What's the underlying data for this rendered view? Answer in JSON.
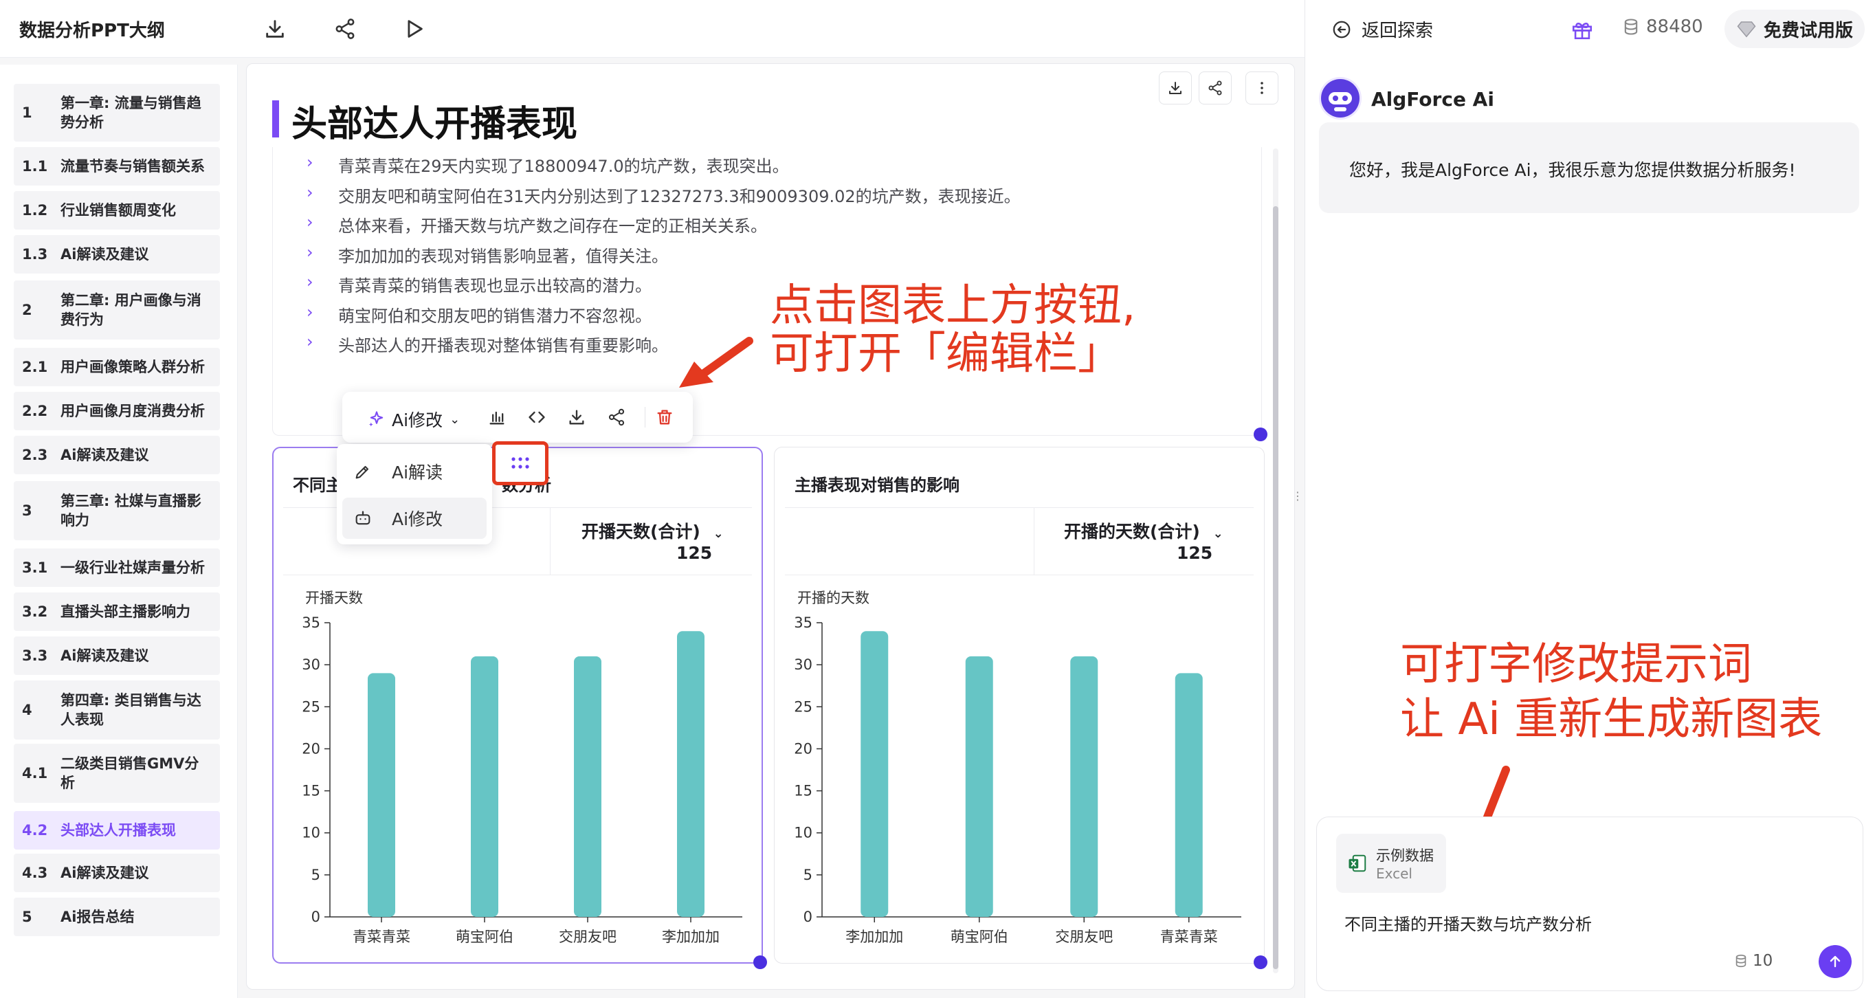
{
  "app": {
    "doc_title": "数据分析PPT大纲"
  },
  "outline": [
    {
      "num": "1",
      "label": "第一章: 流量与销售趋势分析"
    },
    {
      "num": "1.1",
      "label": "流量节奏与销售额关系"
    },
    {
      "num": "1.2",
      "label": "行业销售额周变化"
    },
    {
      "num": "1.3",
      "label": "Ai解读及建议"
    },
    {
      "num": "2",
      "label": "第二章: 用户画像与消费行为"
    },
    {
      "num": "2.1",
      "label": "用户画像策略人群分析"
    },
    {
      "num": "2.2",
      "label": "用户画像月度消费分析"
    },
    {
      "num": "2.3",
      "label": "Ai解读及建议"
    },
    {
      "num": "3",
      "label": "第三章: 社媒与直播影响力"
    },
    {
      "num": "3.1",
      "label": "一级行业社媒声量分析"
    },
    {
      "num": "3.2",
      "label": "直播头部主播影响力"
    },
    {
      "num": "3.3",
      "label": "Ai解读及建议"
    },
    {
      "num": "4",
      "label": "第四章: 类目销售与达人表现"
    },
    {
      "num": "4.1",
      "label": "二级类目销售GMV分析"
    },
    {
      "num": "4.2",
      "label": "头部达人开播表现"
    },
    {
      "num": "4.3",
      "label": "Ai解读及建议"
    },
    {
      "num": "5",
      "label": "Ai报告总结"
    }
  ],
  "slide": {
    "title": "头部达人开播表现",
    "insights": [
      "青菜青菜在29天内实现了18800947.0的坑产数，表现突出。",
      "交朋友吧和萌宝阿伯在31天内分别达到了12327273.3和9009309.02的坑产数，表现接近。",
      "总体来看，开播天数与坑产数之间存在一定的正相关关系。",
      "李加加加的表现对销售影响显著，值得关注。",
      "青菜青菜的销售表现也显示出较高的潜力。",
      "萌宝阿伯和交朋友吧的销售潜力不容忽视。",
      "头部达人的开播表现对整体销售有重要影响。"
    ]
  },
  "annotations": {
    "top_line1": "点击图表上方按钮,",
    "top_line2": "可打开「编辑栏」",
    "bottom_line1": "可打字修改提示词",
    "bottom_line2": "让 Ai 重新生成新图表"
  },
  "toolbar": {
    "ai_edit_label": "Ai修改"
  },
  "dropdown": {
    "items": [
      "Ai解读",
      "Ai修改"
    ]
  },
  "cards": [
    {
      "title_visible_start": "不同主",
      "title_visible_end": "数分析",
      "metric_label": "开播天数(合计)",
      "metric_value": "125",
      "ylabel": "开播天数"
    },
    {
      "title": "主播表现对销售的影响",
      "metric_label": "开播的天数(合计)",
      "metric_value": "125",
      "ylabel": "开播的天数"
    }
  ],
  "chart_data": [
    {
      "type": "bar",
      "categories": [
        "青菜青菜",
        "萌宝阿伯",
        "交朋友吧",
        "李加加加"
      ],
      "values": [
        29,
        31,
        31,
        34
      ],
      "ylabel": "开播天数",
      "ylim": [
        0,
        35
      ],
      "yticks": [
        0,
        5,
        10,
        15,
        20,
        25,
        30,
        35
      ],
      "color": "#66c5c5"
    },
    {
      "type": "bar",
      "categories": [
        "李加加加",
        "萌宝阿伯",
        "交朋友吧",
        "青菜青菜"
      ],
      "values": [
        34,
        31,
        31,
        29
      ],
      "ylabel": "开播的天数",
      "ylim": [
        0,
        35
      ],
      "yticks": [
        0,
        5,
        10,
        15,
        20,
        25,
        30,
        35
      ],
      "color": "#66c5c5"
    }
  ],
  "chat": {
    "back_label": "返回探索",
    "credits": "88480",
    "trial_label": "免费试用版",
    "bot_name": "AlgForce Ai",
    "greeting": "您好，我是AlgForce Ai，我很乐意为您提供数据分析服务!",
    "attachment_name": "示例数据",
    "attachment_type": "Excel",
    "input_text": "不同主播的开播天数与坑产数分析",
    "cost": "10"
  },
  "colors": {
    "accent": "#7b4bf4",
    "annotation": "#e3391f",
    "bar": "#66c5c5",
    "send": "#6a3ef2"
  }
}
